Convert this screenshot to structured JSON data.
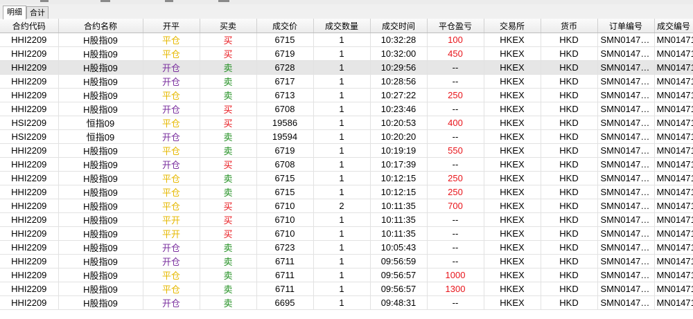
{
  "tabs": [
    {
      "label": "明细",
      "active": true
    },
    {
      "label": "合计",
      "active": false
    }
  ],
  "colors": {
    "open_yellow": "#e6b800",
    "open_purple": "#7a2f9e",
    "buy_red": "#e8141a",
    "sell_green": "#1e8e1e",
    "profit_red": "#e8141a"
  },
  "columns": [
    "合约代码",
    "合约名称",
    "开平",
    "买卖",
    "成交价",
    "成交数量",
    "成交时间",
    "平仓盈亏",
    "交易所",
    "货币",
    "订单编号",
    "成交编号"
  ],
  "rows": [
    {
      "code": "HHI2209",
      "name": "H股指09",
      "oc": "平仓",
      "bs": "买",
      "price": "6715",
      "qty": "1",
      "time": "10:32:28",
      "pnl": "100",
      "exch": "HKEX",
      "cur": "HKD",
      "order": "SMN01471...",
      "trade": "MN01471"
    },
    {
      "code": "HHI2209",
      "name": "H股指09",
      "oc": "平仓",
      "bs": "买",
      "price": "6719",
      "qty": "1",
      "time": "10:32:00",
      "pnl": "450",
      "exch": "HKEX",
      "cur": "HKD",
      "order": "SMN01471...",
      "trade": "MN01471"
    },
    {
      "code": "HHI2209",
      "name": "H股指09",
      "oc": "开仓",
      "bs": "卖",
      "price": "6728",
      "qty": "1",
      "time": "10:29:56",
      "pnl": "--",
      "exch": "HKEX",
      "cur": "HKD",
      "order": "SMN01471...",
      "trade": "MN01471",
      "selected": true
    },
    {
      "code": "HHI2209",
      "name": "H股指09",
      "oc": "开仓",
      "bs": "卖",
      "price": "6717",
      "qty": "1",
      "time": "10:28:56",
      "pnl": "--",
      "exch": "HKEX",
      "cur": "HKD",
      "order": "SMN01471...",
      "trade": "MN01471"
    },
    {
      "code": "HHI2209",
      "name": "H股指09",
      "oc": "平仓",
      "bs": "卖",
      "price": "6713",
      "qty": "1",
      "time": "10:27:22",
      "pnl": "250",
      "exch": "HKEX",
      "cur": "HKD",
      "order": "SMN01471...",
      "trade": "MN01471"
    },
    {
      "code": "HHI2209",
      "name": "H股指09",
      "oc": "开仓",
      "bs": "买",
      "price": "6708",
      "qty": "1",
      "time": "10:23:46",
      "pnl": "--",
      "exch": "HKEX",
      "cur": "HKD",
      "order": "SMN01471...",
      "trade": "MN01471"
    },
    {
      "code": "HSI2209",
      "name": "恒指09",
      "oc": "平仓",
      "bs": "买",
      "price": "19586",
      "qty": "1",
      "time": "10:20:53",
      "pnl": "400",
      "exch": "HKEX",
      "cur": "HKD",
      "order": "SMN01471...",
      "trade": "MN01471"
    },
    {
      "code": "HSI2209",
      "name": "恒指09",
      "oc": "开仓",
      "bs": "卖",
      "price": "19594",
      "qty": "1",
      "time": "10:20:20",
      "pnl": "--",
      "exch": "HKEX",
      "cur": "HKD",
      "order": "SMN01471...",
      "trade": "MN01471"
    },
    {
      "code": "HHI2209",
      "name": "H股指09",
      "oc": "平仓",
      "bs": "卖",
      "price": "6719",
      "qty": "1",
      "time": "10:19:19",
      "pnl": "550",
      "exch": "HKEX",
      "cur": "HKD",
      "order": "SMN01471...",
      "trade": "MN01471"
    },
    {
      "code": "HHI2209",
      "name": "H股指09",
      "oc": "开仓",
      "bs": "买",
      "price": "6708",
      "qty": "1",
      "time": "10:17:39",
      "pnl": "--",
      "exch": "HKEX",
      "cur": "HKD",
      "order": "SMN01471...",
      "trade": "MN01471"
    },
    {
      "code": "HHI2209",
      "name": "H股指09",
      "oc": "平仓",
      "bs": "卖",
      "price": "6715",
      "qty": "1",
      "time": "10:12:15",
      "pnl": "250",
      "exch": "HKEX",
      "cur": "HKD",
      "order": "SMN01471...",
      "trade": "MN01471"
    },
    {
      "code": "HHI2209",
      "name": "H股指09",
      "oc": "平仓",
      "bs": "卖",
      "price": "6715",
      "qty": "1",
      "time": "10:12:15",
      "pnl": "250",
      "exch": "HKEX",
      "cur": "HKD",
      "order": "SMN01471...",
      "trade": "MN01471"
    },
    {
      "code": "HHI2209",
      "name": "H股指09",
      "oc": "平仓",
      "bs": "买",
      "price": "6710",
      "qty": "2",
      "time": "10:11:35",
      "pnl": "700",
      "exch": "HKEX",
      "cur": "HKD",
      "order": "SMN01471...",
      "trade": "MN01471"
    },
    {
      "code": "HHI2209",
      "name": "H股指09",
      "oc": "平开",
      "bs": "买",
      "price": "6710",
      "qty": "1",
      "time": "10:11:35",
      "pnl": "--",
      "exch": "HKEX",
      "cur": "HKD",
      "order": "SMN01471...",
      "trade": "MN01471"
    },
    {
      "code": "HHI2209",
      "name": "H股指09",
      "oc": "平开",
      "bs": "买",
      "price": "6710",
      "qty": "1",
      "time": "10:11:35",
      "pnl": "--",
      "exch": "HKEX",
      "cur": "HKD",
      "order": "SMN01471...",
      "trade": "MN01471"
    },
    {
      "code": "HHI2209",
      "name": "H股指09",
      "oc": "开仓",
      "bs": "卖",
      "price": "6723",
      "qty": "1",
      "time": "10:05:43",
      "pnl": "--",
      "exch": "HKEX",
      "cur": "HKD",
      "order": "SMN01471...",
      "trade": "MN01471"
    },
    {
      "code": "HHI2209",
      "name": "H股指09",
      "oc": "开仓",
      "bs": "卖",
      "price": "6711",
      "qty": "1",
      "time": "09:56:59",
      "pnl": "--",
      "exch": "HKEX",
      "cur": "HKD",
      "order": "SMN01471...",
      "trade": "MN01471"
    },
    {
      "code": "HHI2209",
      "name": "H股指09",
      "oc": "平仓",
      "bs": "卖",
      "price": "6711",
      "qty": "1",
      "time": "09:56:57",
      "pnl": "1000",
      "exch": "HKEX",
      "cur": "HKD",
      "order": "SMN01471...",
      "trade": "MN01471"
    },
    {
      "code": "HHI2209",
      "name": "H股指09",
      "oc": "平仓",
      "bs": "卖",
      "price": "6711",
      "qty": "1",
      "time": "09:56:57",
      "pnl": "1300",
      "exch": "HKEX",
      "cur": "HKD",
      "order": "SMN01471...",
      "trade": "MN01471"
    },
    {
      "code": "HHI2209",
      "name": "H股指09",
      "oc": "开仓",
      "bs": "卖",
      "price": "6695",
      "qty": "1",
      "time": "09:48:31",
      "pnl": "--",
      "exch": "HKEX",
      "cur": "HKD",
      "order": "SMN01471...",
      "trade": "MN01471"
    }
  ]
}
